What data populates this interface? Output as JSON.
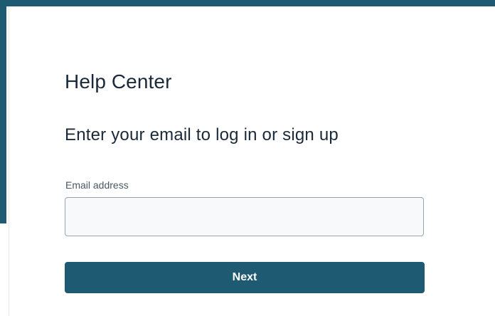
{
  "colors": {
    "accent": "#1f5a73",
    "heading_text": "#1b2a3a",
    "label_text": "#4a5763",
    "input_border": "#9aa4ad",
    "input_background": "#f7f9fb",
    "button_text": "#ffffff"
  },
  "header": {
    "title": "Help Center"
  },
  "form": {
    "prompt": "Enter your email to log in or sign up",
    "email_label": "Email address",
    "email_value": "",
    "email_placeholder": "",
    "next_label": "Next"
  }
}
